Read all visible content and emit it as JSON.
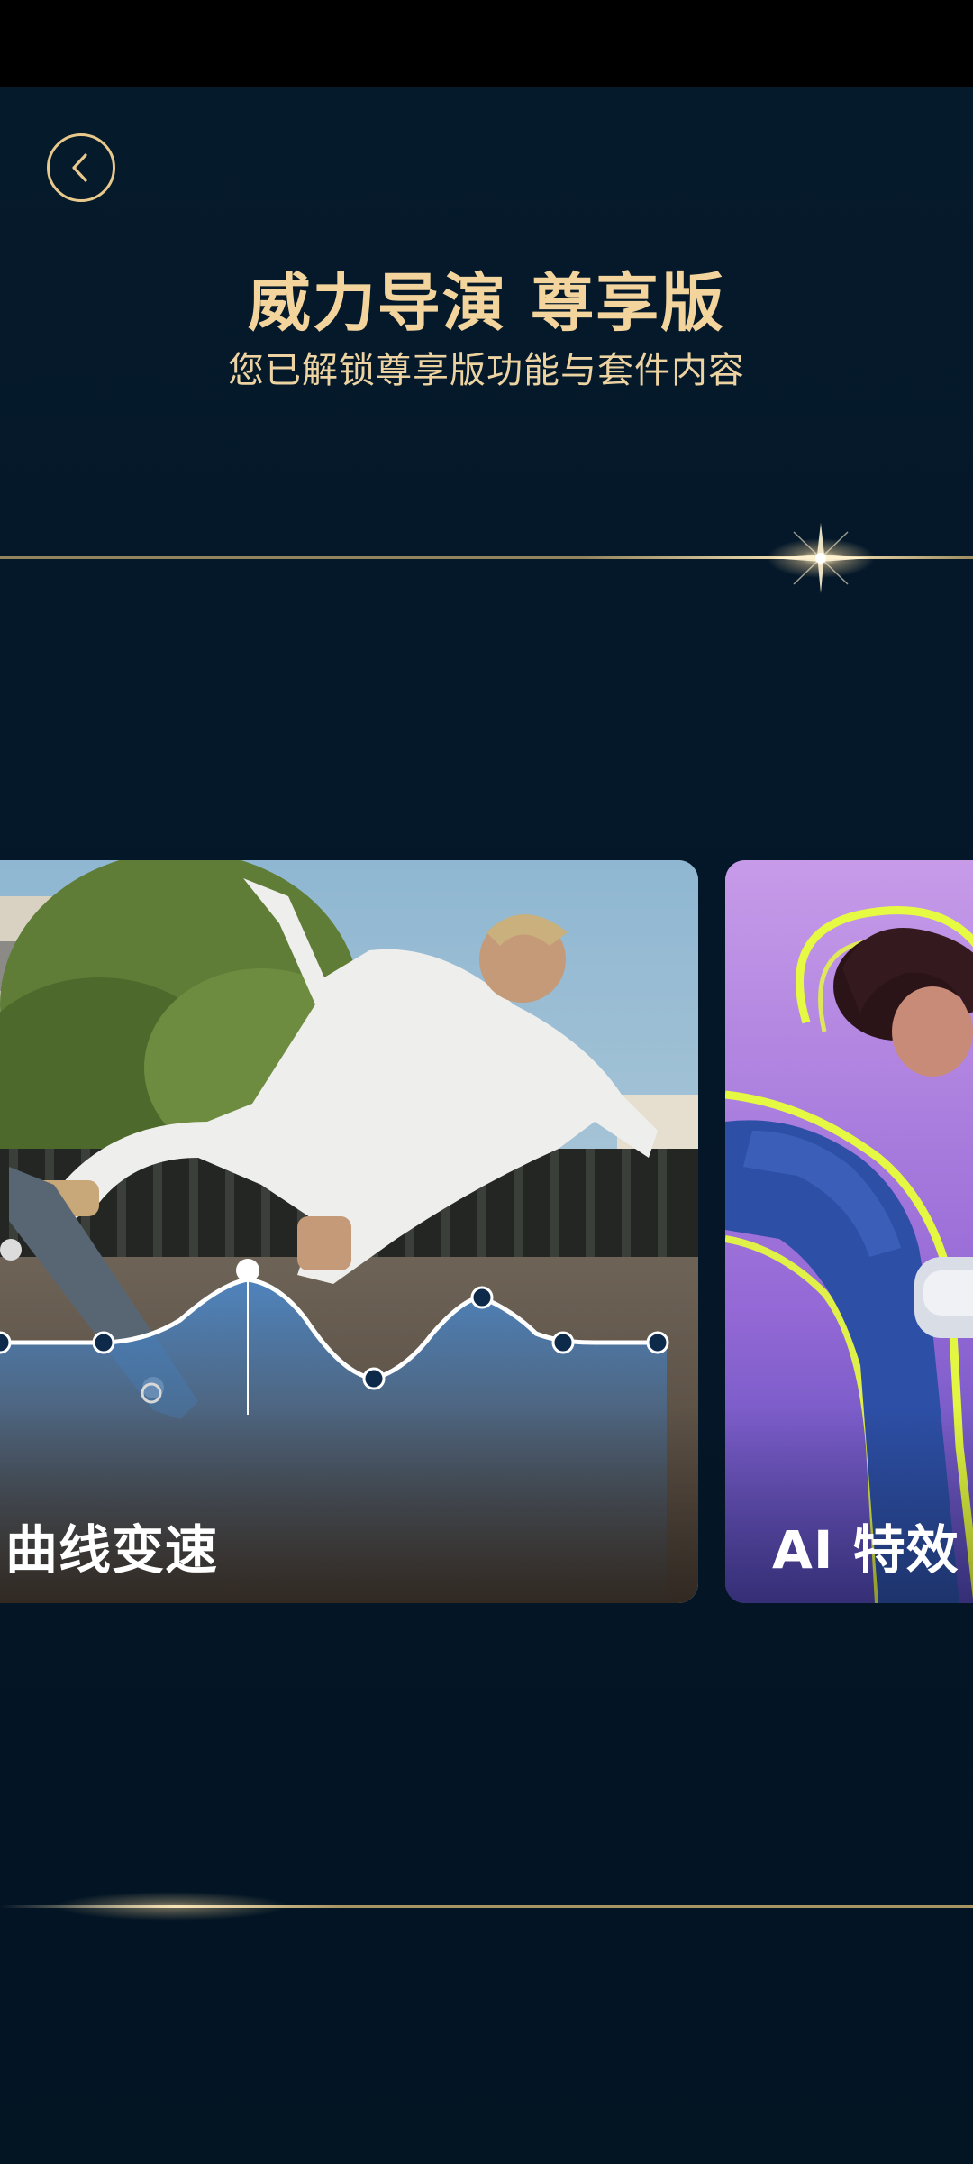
{
  "header": {
    "title": "威力导演 尊享版",
    "subtitle": "您已解锁尊享版功能与套件内容"
  },
  "cards": [
    {
      "label": "曲线变速",
      "icon": "speed-curve-graphic"
    },
    {
      "label": "AI 特效",
      "icon": "neon-glow-graphic"
    }
  ],
  "colors": {
    "background": "#041727",
    "gold": "#f3d49c",
    "accent_line": "#debe78",
    "curve_node": "#0d2a4a",
    "curve_fill": "#3f7fc0",
    "neon": "#e8ff3a"
  }
}
